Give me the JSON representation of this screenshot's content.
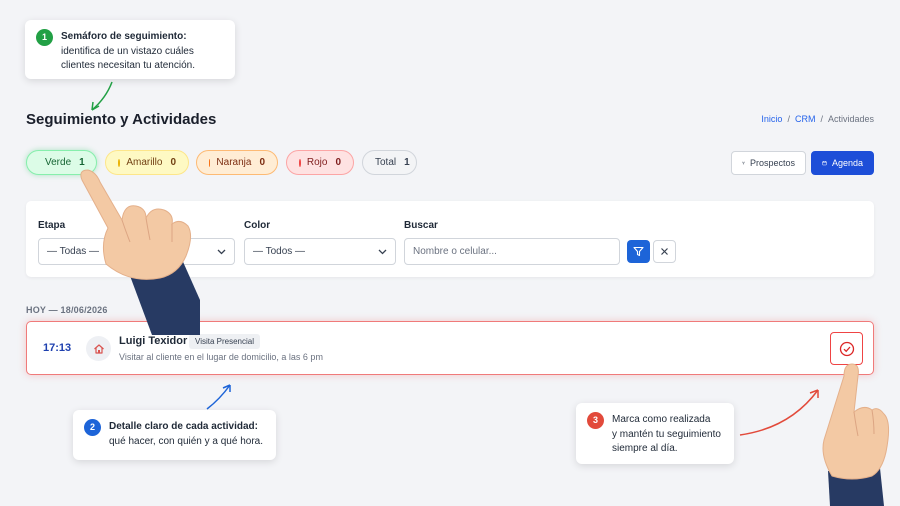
{
  "header": {
    "title": "Seguimiento y Actividades",
    "breadcrumb": {
      "home": "Inicio",
      "crm": "CRM",
      "current": "Actividades",
      "separator": "/"
    }
  },
  "status_filters": [
    {
      "label": "Verde",
      "count": "1",
      "color": "#22c55e"
    },
    {
      "label": "Amarillo",
      "count": "0",
      "color": "#eab308"
    },
    {
      "label": "Naranja",
      "count": "0",
      "color": "#f97316"
    },
    {
      "label": "Rojo",
      "count": "0",
      "color": "#ef4444"
    },
    {
      "label": "Total",
      "count": "1"
    }
  ],
  "toolbar": {
    "prospectos_label": "Prospectos",
    "agenda_label": "Agenda"
  },
  "filters": {
    "etapa": {
      "label": "Etapa",
      "value": "— Todas —"
    },
    "color": {
      "label": "Color",
      "value": "— Todos —"
    },
    "buscar": {
      "label": "Buscar",
      "placeholder": "Nombre o celular..."
    }
  },
  "day": {
    "header": "HOY — 18/06/2026"
  },
  "activity": {
    "time": "17:13",
    "name": "Luigi Texidor",
    "type": "Visita Presencial",
    "description": "Visitar al cliente en el lugar de domicilio, a las 6 pm",
    "icon": "home-icon"
  },
  "callouts": [
    {
      "number": "1",
      "title": "Semáforo de seguimiento:",
      "line1": "identifica de un vistazo cuáles",
      "line2": "clientes necesitan tu atención."
    },
    {
      "number": "2",
      "title": "Detalle claro de cada actividad:",
      "line1": "qué hacer, con quién y a qué hora."
    },
    {
      "number": "3",
      "line1": "Marca como realizada",
      "line2": "y mantén tu seguimiento",
      "line3": "siempre al día."
    }
  ],
  "colors": {
    "accent": "#1d4ed8",
    "danger": "#ef4444",
    "success": "#22a045"
  }
}
